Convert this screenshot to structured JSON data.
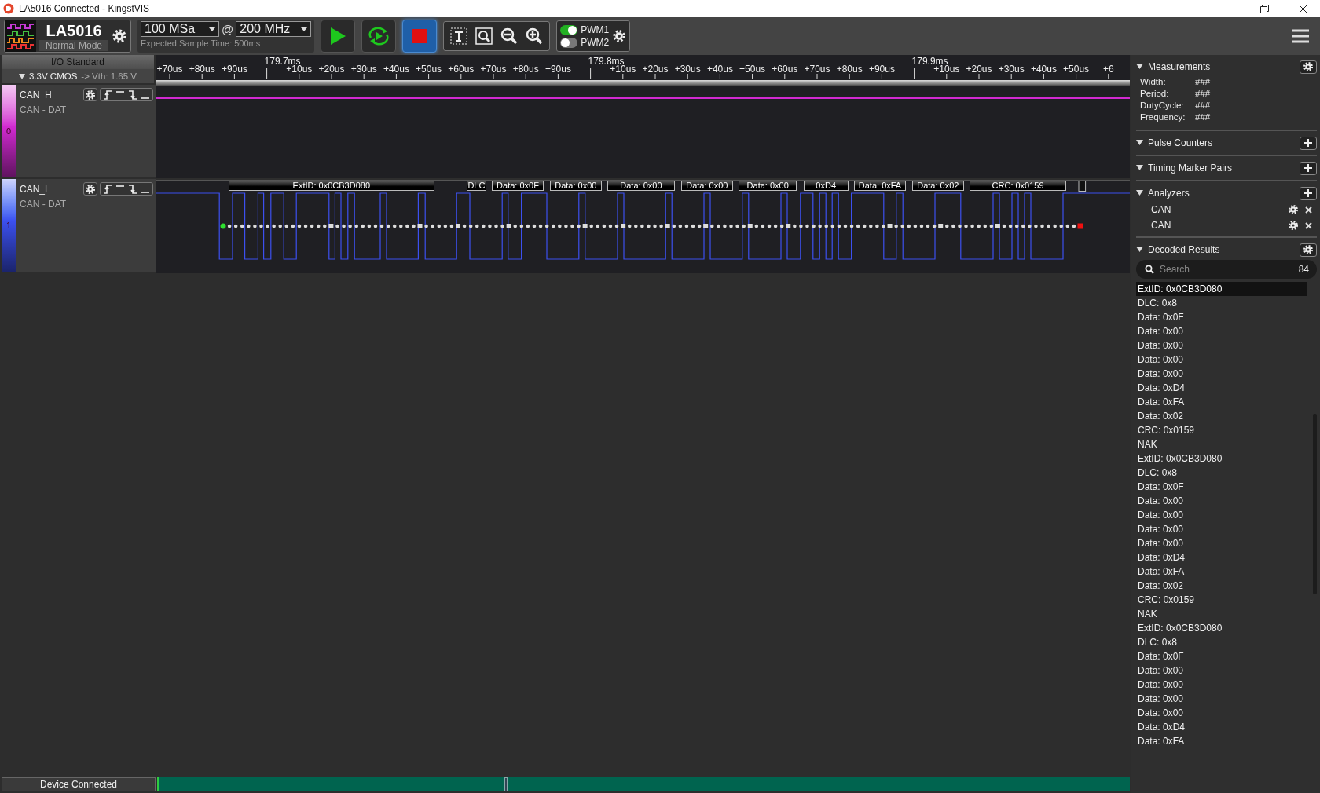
{
  "window": {
    "title": "LA5016 Connected - KingstVIS"
  },
  "device": {
    "model": "LA5016",
    "mode": "Normal Mode"
  },
  "sampling": {
    "depth": "100 MSa",
    "at": "@",
    "rate": "200 MHz",
    "expected": "Expected Sample Time: 500ms"
  },
  "pwm": [
    {
      "label": "PWM1",
      "on": true
    },
    {
      "label": "PWM2",
      "on": false
    }
  ],
  "io_standard": {
    "title": "I/O Standard",
    "value": "3.3V CMOS",
    "vth": "-> Vth: 1.65 V"
  },
  "ruler": {
    "ticks": [
      {
        "label": "+70us",
        "kind": "minor"
      },
      {
        "label": "+80us",
        "kind": "minor"
      },
      {
        "label": "+90us",
        "kind": "minor"
      },
      {
        "label": "179.7ms",
        "kind": "major"
      },
      {
        "label": "+10us",
        "kind": "minor"
      },
      {
        "label": "+20us",
        "kind": "minor"
      },
      {
        "label": "+30us",
        "kind": "minor"
      },
      {
        "label": "+40us",
        "kind": "minor"
      },
      {
        "label": "+50us",
        "kind": "minor"
      },
      {
        "label": "+60us",
        "kind": "minor"
      },
      {
        "label": "+70us",
        "kind": "minor"
      },
      {
        "label": "+80us",
        "kind": "minor"
      },
      {
        "label": "+90us",
        "kind": "minor"
      },
      {
        "label": "179.8ms",
        "kind": "major"
      },
      {
        "label": "+10us",
        "kind": "minor"
      },
      {
        "label": "+20us",
        "kind": "minor"
      },
      {
        "label": "+30us",
        "kind": "minor"
      },
      {
        "label": "+40us",
        "kind": "minor"
      },
      {
        "label": "+50us",
        "kind": "minor"
      },
      {
        "label": "+60us",
        "kind": "minor"
      },
      {
        "label": "+70us",
        "kind": "minor"
      },
      {
        "label": "+80us",
        "kind": "minor"
      },
      {
        "label": "+90us",
        "kind": "minor"
      },
      {
        "label": "179.9ms",
        "kind": "major"
      },
      {
        "label": "+10us",
        "kind": "minor"
      },
      {
        "label": "+20us",
        "kind": "minor"
      },
      {
        "label": "+30us",
        "kind": "minor"
      },
      {
        "label": "+40us",
        "kind": "minor"
      },
      {
        "label": "+50us",
        "kind": "minor"
      },
      {
        "label": "+6",
        "kind": "minor"
      }
    ]
  },
  "channels": [
    {
      "index": "0",
      "name": "CAN_H",
      "protocol": "CAN - DAT",
      "color": "#d22ad2"
    },
    {
      "index": "1",
      "name": "CAN_L",
      "protocol": "CAN - DAT",
      "color": "#3c50f0",
      "decodes": [
        "ExtID: 0x0CB3D080",
        "DLC",
        "Data: 0x0F",
        "Data: 0x00",
        "Data: 0x00",
        "Data: 0x00",
        "Data: 0x00",
        "0xD4",
        "Data: 0xFA",
        "Data: 0x02",
        "CRC: 0x0159"
      ]
    }
  ],
  "measurements": {
    "title": "Measurements",
    "rows": [
      {
        "label": "Width:",
        "value": "###"
      },
      {
        "label": "Period:",
        "value": "###"
      },
      {
        "label": "DutyCycle:",
        "value": "###"
      },
      {
        "label": "Frequency:",
        "value": "###"
      }
    ]
  },
  "pulse_counters": {
    "title": "Pulse Counters"
  },
  "timing_marker_pairs": {
    "title": "Timing Marker Pairs"
  },
  "analyzers": {
    "title": "Analyzers",
    "items": [
      "CAN",
      "CAN"
    ]
  },
  "decoded_results": {
    "title": "Decoded Results",
    "search": {
      "placeholder": "Search"
    },
    "count": "84",
    "rows": [
      {
        "text": "ExtID: 0x0CB3D080",
        "selected": true
      },
      {
        "text": "DLC: 0x8",
        "selected": false
      },
      {
        "text": "Data: 0x0F",
        "selected": false
      },
      {
        "text": "Data: 0x00",
        "selected": false
      },
      {
        "text": "Data: 0x00",
        "selected": false
      },
      {
        "text": "Data: 0x00",
        "selected": false
      },
      {
        "text": "Data: 0x00",
        "selected": false
      },
      {
        "text": "Data: 0xD4",
        "selected": false
      },
      {
        "text": "Data: 0xFA",
        "selected": false
      },
      {
        "text": "Data: 0x02",
        "selected": false
      },
      {
        "text": "CRC: 0x0159",
        "selected": false
      },
      {
        "text": "NAK",
        "selected": false
      },
      {
        "text": "ExtID: 0x0CB3D080",
        "selected": false
      },
      {
        "text": "DLC: 0x8",
        "selected": false
      },
      {
        "text": "Data: 0x0F",
        "selected": false
      },
      {
        "text": "Data: 0x00",
        "selected": false
      },
      {
        "text": "Data: 0x00",
        "selected": false
      },
      {
        "text": "Data: 0x00",
        "selected": false
      },
      {
        "text": "Data: 0x00",
        "selected": false
      },
      {
        "text": "Data: 0xD4",
        "selected": false
      },
      {
        "text": "Data: 0xFA",
        "selected": false
      },
      {
        "text": "Data: 0x02",
        "selected": false
      },
      {
        "text": "CRC: 0x0159",
        "selected": false
      },
      {
        "text": "NAK",
        "selected": false
      },
      {
        "text": "ExtID: 0x0CB3D080",
        "selected": false
      },
      {
        "text": "DLC: 0x8",
        "selected": false
      },
      {
        "text": "Data: 0x0F",
        "selected": false
      },
      {
        "text": "Data: 0x00",
        "selected": false
      },
      {
        "text": "Data: 0x00",
        "selected": false
      },
      {
        "text": "Data: 0x00",
        "selected": false
      },
      {
        "text": "Data: 0x00",
        "selected": false
      },
      {
        "text": "Data: 0xD4",
        "selected": false
      },
      {
        "text": "Data: 0xFA",
        "selected": false
      }
    ]
  },
  "status_bar": {
    "text": "Device Connected"
  }
}
